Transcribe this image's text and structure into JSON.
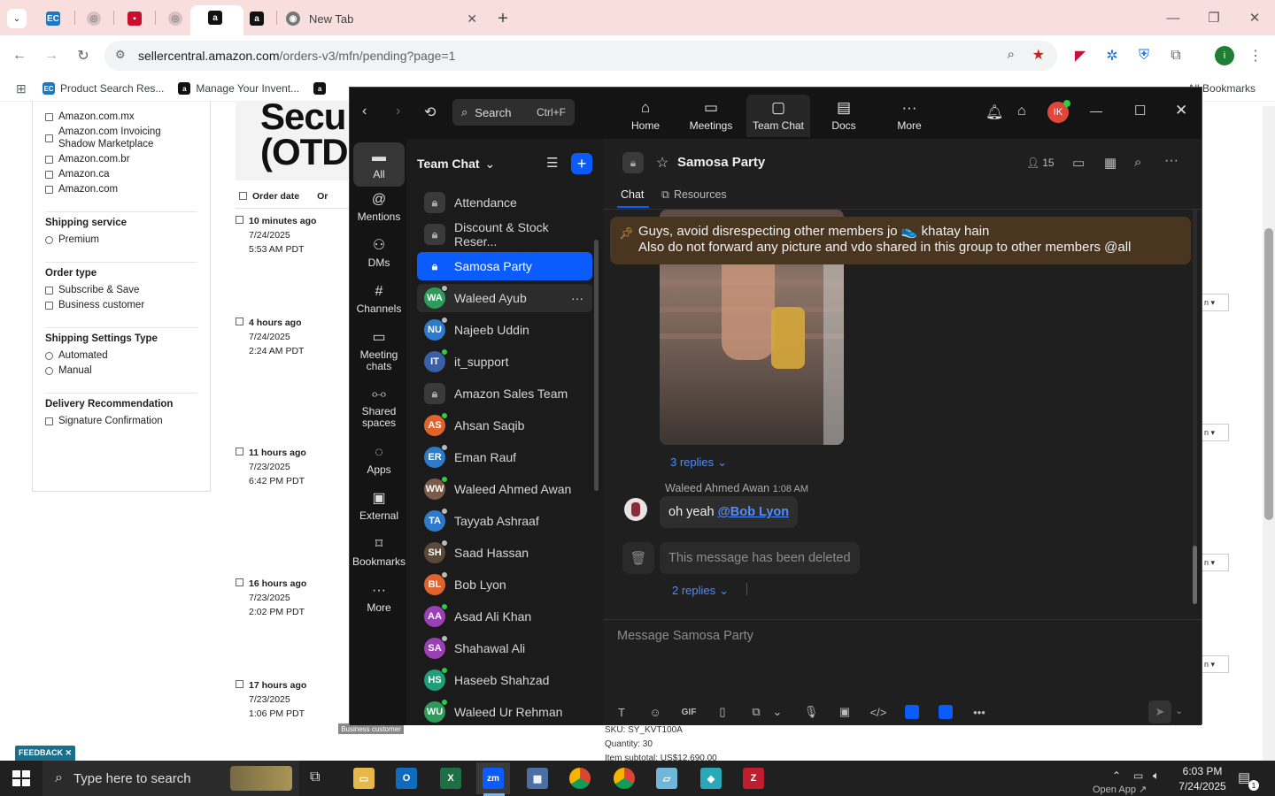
{
  "browser": {
    "tabs": [
      {
        "icon": "ec-favicon"
      },
      {
        "icon": "globe-favicon"
      },
      {
        "icon": "red-favicon"
      },
      {
        "icon": "globe-favicon"
      },
      {
        "icon": "amazon-favicon",
        "active": true
      },
      {
        "icon": "amazon-favicon"
      },
      {
        "label": "New Tab",
        "icon": "chrome-favicon"
      }
    ],
    "url_host": "sellercentral.amazon.com",
    "url_path": "/orders-v3/mfn/pending?page=1",
    "bookmarks": [
      {
        "label": "Product Search Res...",
        "icon": "ec-favicon"
      },
      {
        "label": "Manage Your Invent...",
        "icon": "amazon-favicon"
      },
      {
        "label": "",
        "icon": "amazon-favicon"
      }
    ],
    "all_bookmarks": "All Bookmarks",
    "profile_initial": "i"
  },
  "seller": {
    "marketplaces": [
      "Amazon.com.mx",
      "Amazon.com Invoicing Shadow Marketplace",
      "Amazon.com.br",
      "Amazon.ca",
      "Amazon.com"
    ],
    "shipping_service_title": "Shipping service",
    "shipping_service_options": [
      "Premium"
    ],
    "order_type_title": "Order type",
    "order_type_options": [
      "Subscribe & Save",
      "Business customer"
    ],
    "shipping_settings_title": "Shipping Settings Type",
    "shipping_settings_options": [
      "Automated",
      "Manual"
    ],
    "delivery_title": "Delivery Recommendation",
    "delivery_options": [
      "Signature Confirmation"
    ],
    "order_date_header": "Order date",
    "order_header_trunc": "Or",
    "big_title_line1": "Secu",
    "big_title_line2": "(OTD",
    "orders": [
      {
        "ago": "10 minutes ago",
        "date": "7/24/2025",
        "time": "5:53 AM PDT"
      },
      {
        "ago": "4 hours ago",
        "date": "7/24/2025",
        "time": "2:24 AM PDT"
      },
      {
        "ago": "11 hours ago",
        "date": "7/23/2025",
        "time": "6:42 PM PDT"
      },
      {
        "ago": "16 hours ago",
        "date": "7/23/2025",
        "time": "2:02 PM PDT"
      },
      {
        "ago": "17 hours ago",
        "date": "7/23/2025",
        "time": "1:06 PM PDT"
      }
    ],
    "right_button": "n ▾",
    "sku": "SKU: SY_KVT100A",
    "quantity": "Quantity: 30",
    "subtotal": "Item subtotal: US$12,690.00",
    "business_customer_tag": "Business customer",
    "feedback": "FEEDBACK ✕"
  },
  "zoom": {
    "search_label": "Search",
    "search_shortcut": "Ctrl+F",
    "top_nav": [
      {
        "label": "Home",
        "icon": "home-icon"
      },
      {
        "label": "Meetings",
        "icon": "video-icon"
      },
      {
        "label": "Team Chat",
        "icon": "chat-icon"
      },
      {
        "label": "Docs",
        "icon": "docs-icon"
      },
      {
        "label": "More",
        "icon": "more-icon"
      }
    ],
    "avatar_initials": "IK",
    "left_nav": [
      {
        "label": "All",
        "icon": "chat-bubble-icon"
      },
      {
        "label": "Mentions",
        "icon": "at-icon"
      },
      {
        "label": "DMs",
        "icon": "people-icon"
      },
      {
        "label": "Channels",
        "icon": "hash-icon"
      },
      {
        "label": "Meeting chats",
        "icon": "calendar-icon"
      },
      {
        "label": "Shared spaces",
        "icon": "shared-icon"
      },
      {
        "label": "Apps",
        "icon": "apps-icon"
      },
      {
        "label": "External",
        "icon": "external-icon"
      },
      {
        "label": "Bookmarks",
        "icon": "bookmark-icon"
      },
      {
        "label": "More",
        "icon": "more-icon"
      }
    ],
    "list_title": "Team Chat",
    "channels": [
      {
        "name": "Attendance",
        "type": "lock"
      },
      {
        "name": "Discount & Stock Reser...",
        "type": "lock"
      },
      {
        "name": "Samosa Party",
        "type": "lock",
        "selected": true
      },
      {
        "name": "Waleed Ayub",
        "initials": "WA",
        "color": "#2e9b5a",
        "presence": "#bbbbbb",
        "hover": true
      },
      {
        "name": "Najeeb Uddin",
        "initials": "NU",
        "color": "#2f7ac8",
        "presence": "#bbbbbb"
      },
      {
        "name": "it_support",
        "initials": "IT",
        "color": "#3b5ea8",
        "presence": "#2ecc40"
      },
      {
        "name": "Amazon Sales Team",
        "type": "lock"
      },
      {
        "name": "Ahsan Saqib",
        "initials": "AS",
        "color": "#e0632c",
        "presence": "#2ecc40"
      },
      {
        "name": "Eman Rauf",
        "initials": "ER",
        "color": "#2f7ac8",
        "presence": "#bbbbbb"
      },
      {
        "name": "Waleed Ahmed Awan",
        "initials": "WW",
        "color": "#7a5a4a",
        "presence": "#2ecc40"
      },
      {
        "name": "Tayyab Ashraaf",
        "initials": "TA",
        "color": "#2f7ac8",
        "presence": "#bbbbbb"
      },
      {
        "name": "Saad Hassan",
        "initials": "SH",
        "color": "#5b4a3a",
        "presence": "#bbbbbb"
      },
      {
        "name": "Bob Lyon",
        "initials": "BL",
        "color": "#e0632c",
        "presence": "#bbbbbb"
      },
      {
        "name": "Asad Ali Khan",
        "initials": "AA",
        "color": "#9b3fb5",
        "presence": "#2ecc40"
      },
      {
        "name": "Shahawal Ali",
        "initials": "SA",
        "color": "#9b3fb5",
        "presence": "#bbbbbb"
      },
      {
        "name": "Haseeb Shahzad",
        "initials": "HS",
        "color": "#1f9e7a",
        "presence": "#2ecc40"
      },
      {
        "name": "Waleed Ur Rehman",
        "initials": "WU",
        "color": "#2e9b5a",
        "presence": "#2ecc40"
      }
    ],
    "chat_title": "Samosa Party",
    "member_count": "15",
    "tabs": [
      "Chat",
      "Resources"
    ],
    "pinned_line1": "Guys, avoid disrespecting other members jo 👟 khatay hain",
    "pinned_line2": "Also do not forward any picture and vdo shared in this group to other members @all",
    "replies_1": "3 replies",
    "message_sender": "Waleed Ahmed Awan",
    "message_time": "1:08 AM",
    "message_text": "oh yeah ",
    "message_mention": "@Bob Lyon",
    "deleted_text": "This message has been deleted",
    "replies_2": "2 replies",
    "composer_placeholder": "Message Samosa Party",
    "composer_tools": [
      "T",
      "☺",
      "GIF",
      "▯",
      "⧉",
      "⌄",
      "🎙",
      "▣",
      "</>",
      "",
      "",
      "•••"
    ]
  },
  "taskbar": {
    "search_placeholder": "Type here to search",
    "time": "6:03 PM",
    "date": "7/24/2025",
    "notification_count": "1",
    "open_app": "Open App ↗"
  },
  "colors": {
    "zoom_blue": "#0b5cff",
    "pin_bg": "#493620",
    "tab_strip": "#f9dede",
    "amazon_orange": "#ff9900"
  }
}
